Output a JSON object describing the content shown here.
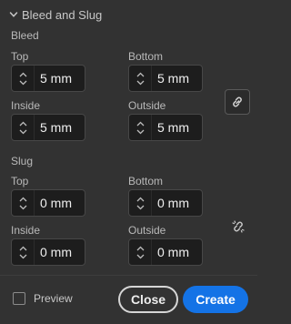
{
  "section": {
    "title": "Bleed and Slug",
    "expanded": true
  },
  "bleed": {
    "label": "Bleed",
    "top": {
      "label": "Top",
      "value": "5 mm"
    },
    "bottom": {
      "label": "Bottom",
      "value": "5 mm"
    },
    "inside": {
      "label": "Inside",
      "value": "5 mm"
    },
    "outside": {
      "label": "Outside",
      "value": "5 mm"
    },
    "link_icon": "link-icon",
    "linked": true
  },
  "slug": {
    "label": "Slug",
    "top": {
      "label": "Top",
      "value": "0 mm"
    },
    "bottom": {
      "label": "Bottom",
      "value": "0 mm"
    },
    "inside": {
      "label": "Inside",
      "value": "0 mm"
    },
    "outside": {
      "label": "Outside",
      "value": "0 mm"
    },
    "link_icon": "unlink-icon",
    "linked": false
  },
  "footer": {
    "preview_label": "Preview",
    "preview_checked": false,
    "close_label": "Close",
    "create_label": "Create"
  },
  "colors": {
    "background": "#323232",
    "accent": "#1473e6",
    "field_bg": "#1d1d1d"
  }
}
